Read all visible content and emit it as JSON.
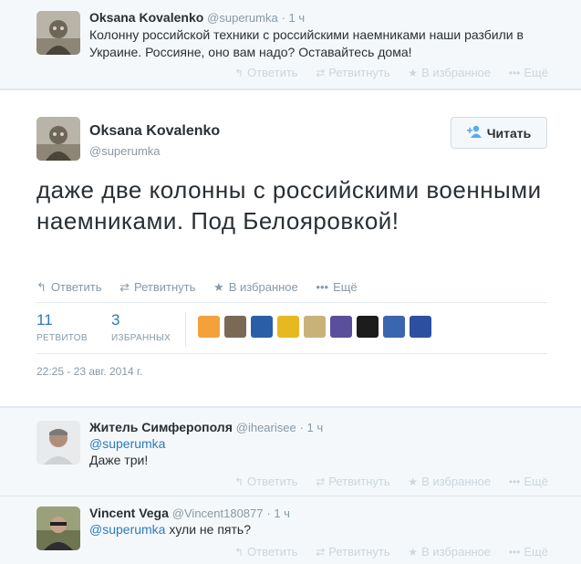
{
  "tweet_top": {
    "name": "Oksana Kovalenko",
    "handle": "@superumka",
    "time": "· 1 ч",
    "text": "Колонну российской техники с российскими наемниками наши разбили в Украине. Россияне, оно вам надо? Оставайтесь дома!"
  },
  "actions": {
    "reply": "Ответить",
    "retweet": "Ретвитнуть",
    "favorite": "В избранное",
    "more": "Ещё"
  },
  "main": {
    "name": "Oksana Kovalenko",
    "handle": "@superumka",
    "follow_label": "Читать",
    "text": "даже две колонны с российскими военными наемниками. Под Белояровкой!",
    "retweets_count": "11",
    "retweets_label": "РЕТВИТОВ",
    "favorites_count": "3",
    "favorites_label": "ИЗБРАННЫХ",
    "date": "22:25 - 23 авг. 2014 г.",
    "face_colors": [
      "#f4a13b",
      "#7a6a55",
      "#2a5fa8",
      "#e8b820",
      "#c9b27a",
      "#5a4f9a",
      "#1c1c1c",
      "#3a66b0",
      "#2c4fa0"
    ]
  },
  "reply1": {
    "name": "Житель Симферополя",
    "handle": "@ihearisee",
    "time": "· 1 ч",
    "mention": "@superumka",
    "text": "Даже три!"
  },
  "reply2": {
    "name": "Vincent Vega",
    "handle": "@Vincent180877",
    "time": "· 1 ч",
    "mention": "@superumka",
    "text": " хули не пять?"
  }
}
